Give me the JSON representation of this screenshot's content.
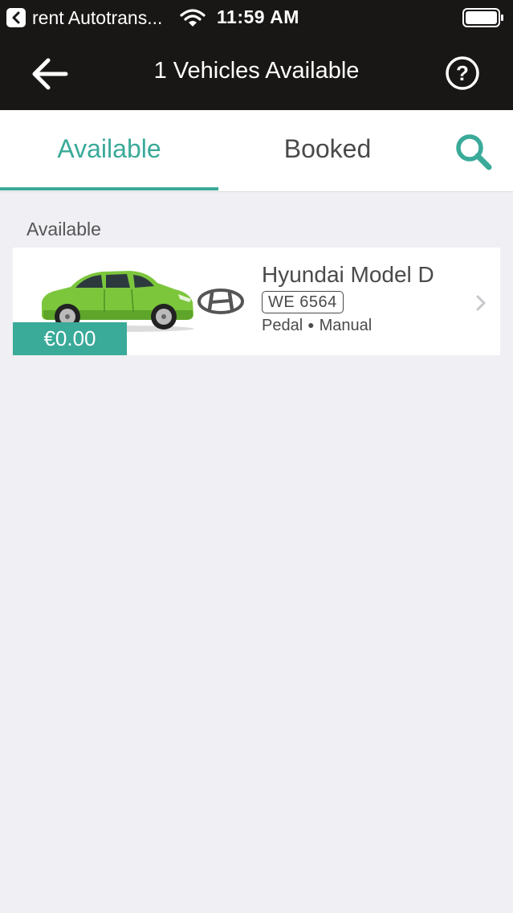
{
  "status_bar": {
    "back_app_label": "rent Autotrans...",
    "time": "11:59 AM"
  },
  "nav": {
    "title": "1 Vehicles Available"
  },
  "tabs": [
    {
      "label": "Available",
      "active": true
    },
    {
      "label": "Booked",
      "active": false
    }
  ],
  "section": {
    "title": "Available"
  },
  "vehicles": [
    {
      "name": "Hyundai Model D",
      "plate": "WE 6564",
      "spec_1": "Pedal",
      "spec_2": "Manual",
      "price": "€0.00",
      "car_color": "#7cc63c"
    }
  ],
  "colors": {
    "accent": "#3aaa99",
    "header_bg": "#191716",
    "page_bg": "#efeff4"
  }
}
